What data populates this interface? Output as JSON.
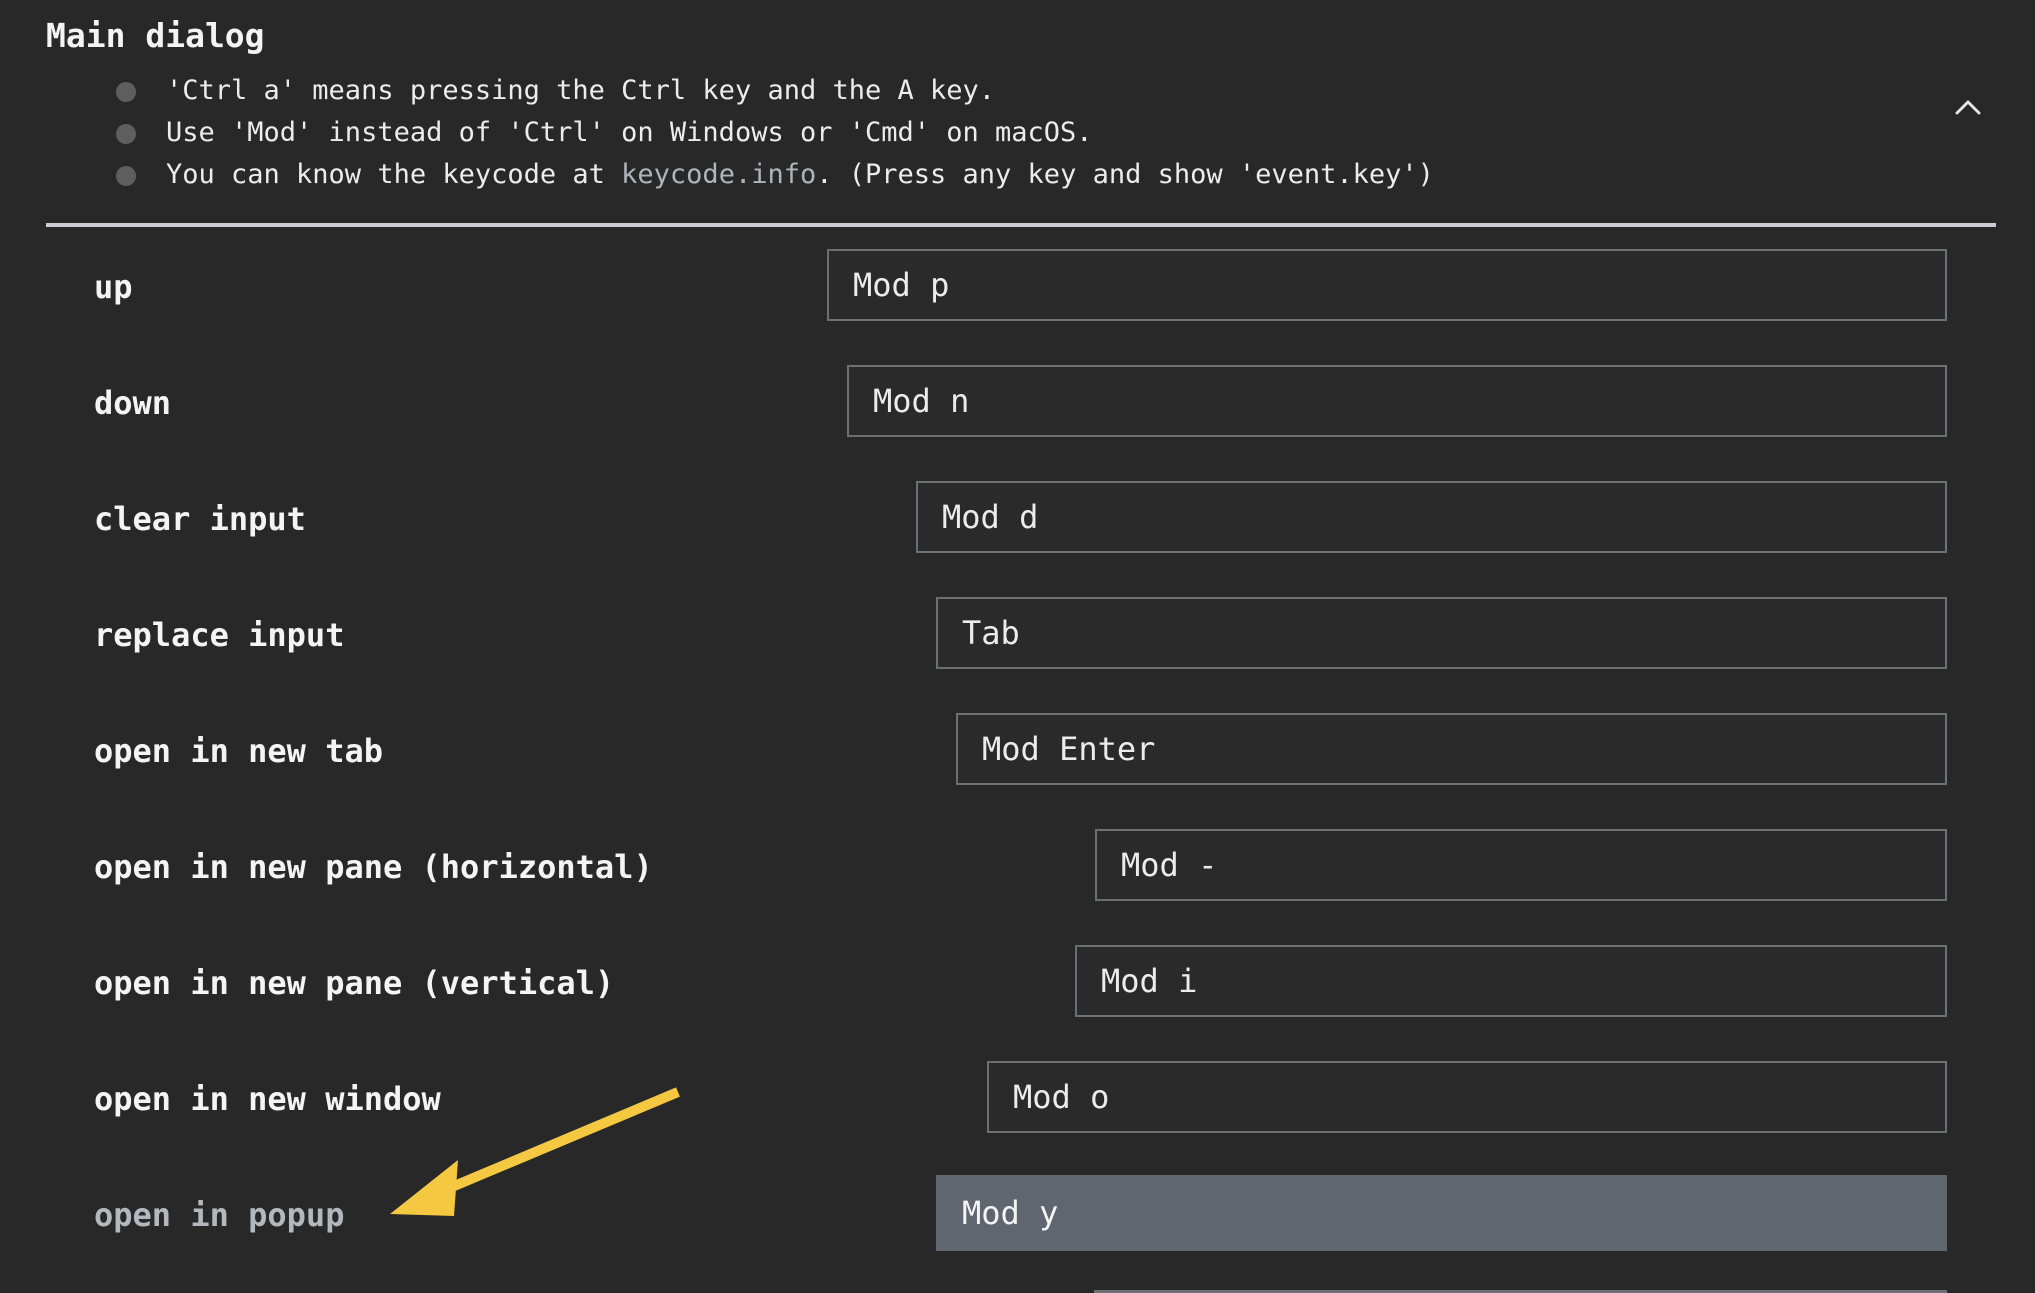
{
  "section": {
    "title": "Main dialog"
  },
  "notes": [
    {
      "text": "'Ctrl a' means pressing the Ctrl key and the A key."
    },
    {
      "text": "Use 'Mod' instead of 'Ctrl' on Windows or 'Cmd' on macOS."
    },
    {
      "before": "You can know the keycode at ",
      "link": "keycode.info",
      "after": ". (Press any key and show 'event.key')"
    }
  ],
  "collapse_icon": "chevron-up-icon",
  "bindings": [
    {
      "label": "up",
      "value": "Mod p"
    },
    {
      "label": "down",
      "value": "Mod n"
    },
    {
      "label": "clear input",
      "value": "Mod d"
    },
    {
      "label": "replace input",
      "value": "Tab"
    },
    {
      "label": "open in new tab",
      "value": "Mod Enter"
    },
    {
      "label": "open in new pane (horizontal)",
      "value": "Mod -"
    },
    {
      "label": "open in new pane (vertical)",
      "value": "Mod i"
    },
    {
      "label": "open in new window",
      "value": "Mod o"
    },
    {
      "label": "open in popup",
      "value": "Mod y"
    }
  ],
  "colors": {
    "background": "#282828",
    "divider": "#c9cdd3",
    "input_border": "#6c6f74",
    "active_input": "#5f666f",
    "annotation_arrow": "#f5c842"
  }
}
